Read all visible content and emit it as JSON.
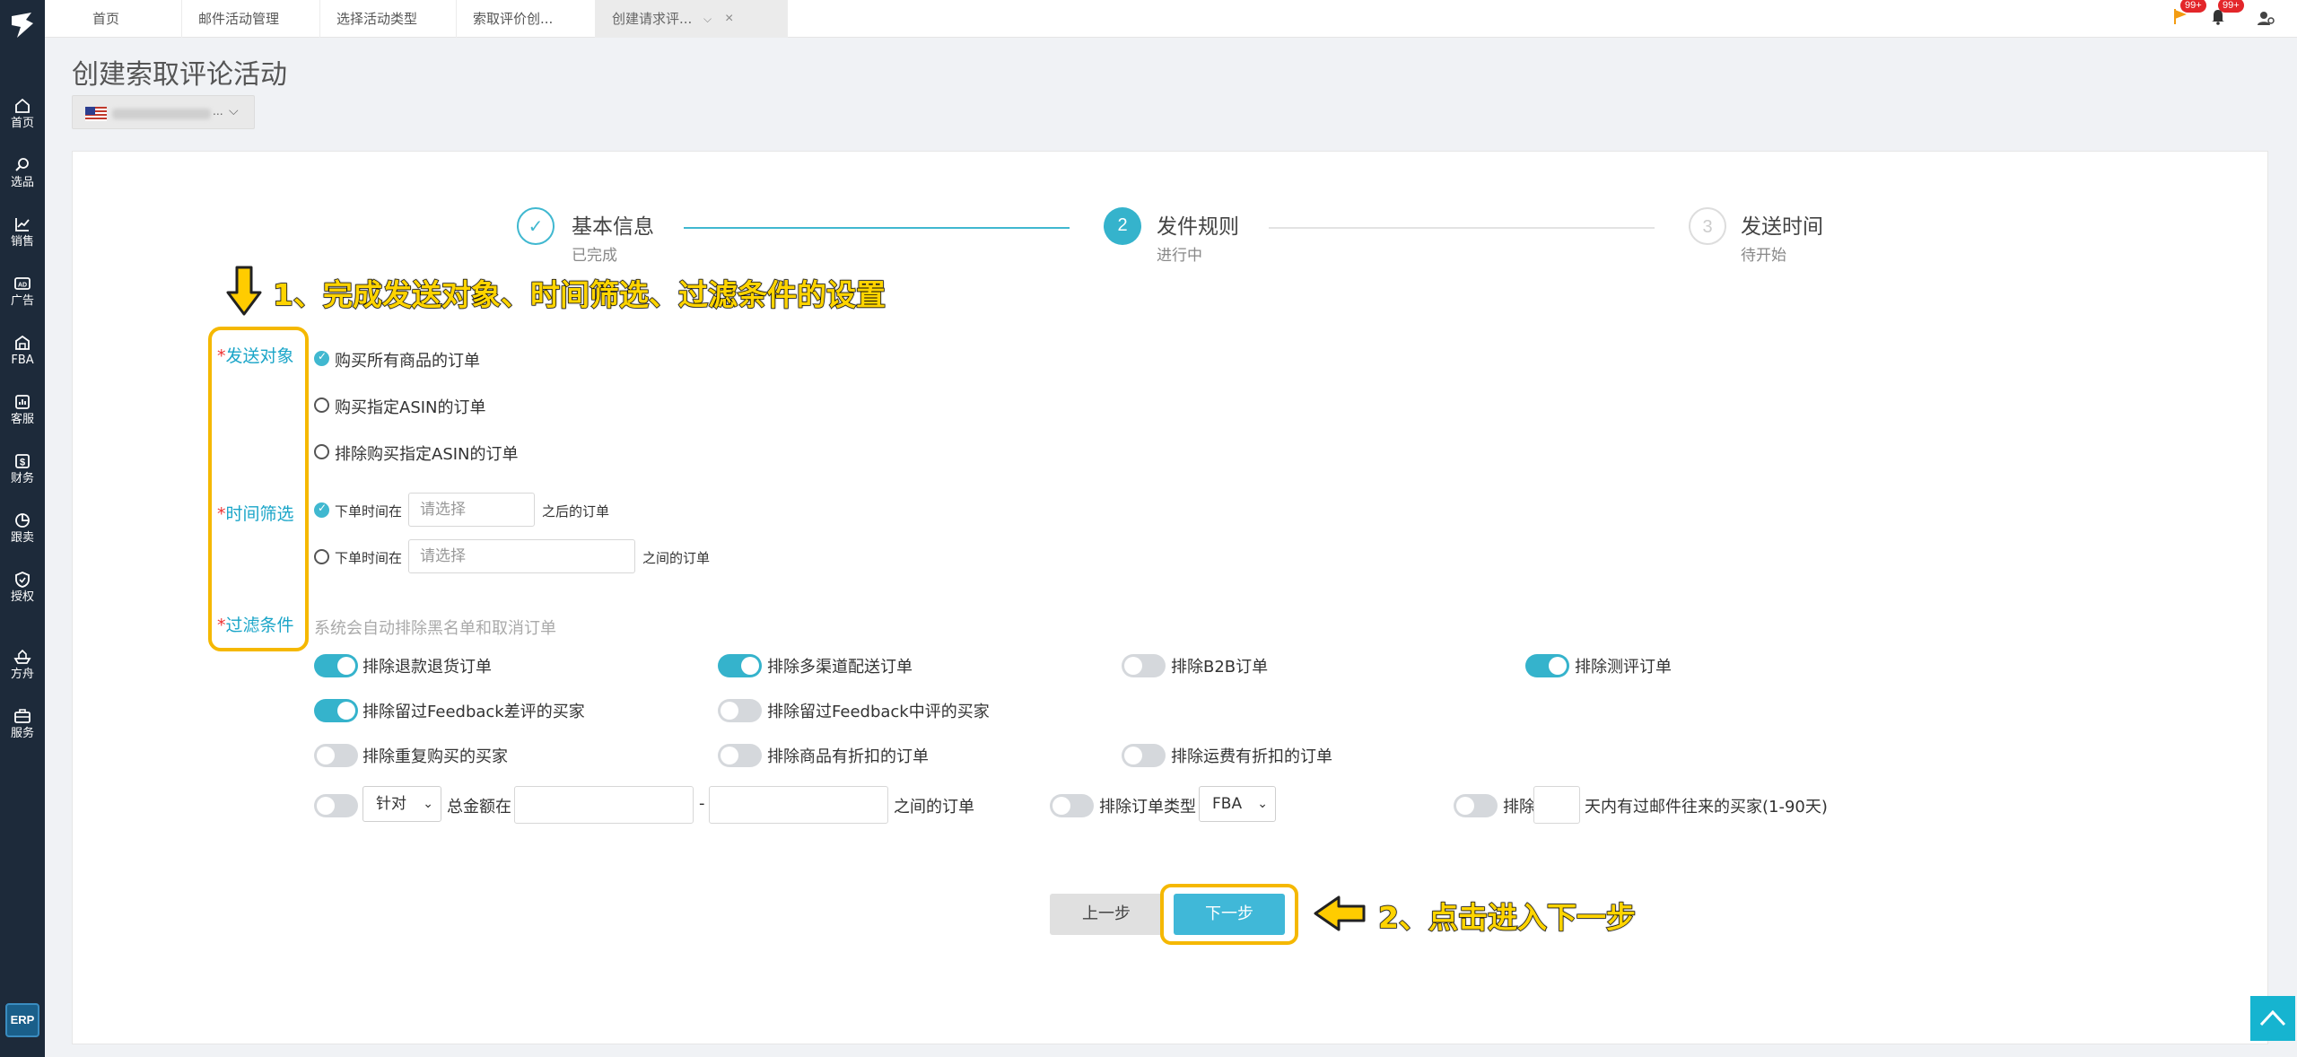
{
  "sidebar": {
    "items": [
      {
        "label": "首页",
        "icon": "home-icon"
      },
      {
        "label": "选品",
        "icon": "search-icon"
      },
      {
        "label": "销售",
        "icon": "chart-icon"
      },
      {
        "label": "广告",
        "icon": "ad-icon"
      },
      {
        "label": "FBA",
        "icon": "warehouse-icon"
      },
      {
        "label": "客服",
        "icon": "service-icon"
      },
      {
        "label": "财务",
        "icon": "finance-icon"
      },
      {
        "label": "跟卖",
        "icon": "pie-icon"
      },
      {
        "label": "授权",
        "icon": "shield-icon"
      },
      {
        "label": "方舟",
        "icon": "ark-icon"
      },
      {
        "label": "服务",
        "icon": "briefcase-icon"
      }
    ],
    "erp_label": "ERP"
  },
  "tabs": [
    {
      "label": "首页"
    },
    {
      "label": "邮件活动管理"
    },
    {
      "label": "选择活动类型"
    },
    {
      "label": "索取评价创..."
    },
    {
      "label": "创建请求评..."
    }
  ],
  "topbar": {
    "flag_badge": "99+",
    "bell_badge": "99+"
  },
  "page": {
    "title": "创建索取评论活动",
    "store_ellipsis": "..."
  },
  "steps": [
    {
      "number": "✓",
      "title": "基本信息",
      "status": "已完成"
    },
    {
      "number": "2",
      "title": "发件规则",
      "status": "进行中"
    },
    {
      "number": "3",
      "title": "发送时间",
      "status": "待开始"
    }
  ],
  "annotations": {
    "step1": "1、完成发送对象、时间筛选、过滤条件的设置",
    "step2": "2、点击进入下一步"
  },
  "form": {
    "recipient": {
      "label": "发送对象",
      "options": [
        "购买所有商品的订单",
        "购买指定ASIN的订单",
        "排除购买指定ASIN的订单"
      ],
      "selected": 0
    },
    "time": {
      "label": "时间筛选",
      "row1": {
        "prefix": "下单时间在",
        "placeholder": "请选择",
        "suffix": "之后的订单"
      },
      "row2": {
        "prefix": "下单时间在",
        "placeholder": "请选择",
        "suffix": "之间的订单"
      }
    },
    "filter": {
      "label": "过滤条件",
      "hint": "系统会自动排除黑名单和取消订单",
      "toggles": [
        {
          "label": "排除退款退货订单",
          "on": true
        },
        {
          "label": "排除多渠道配送订单",
          "on": true
        },
        {
          "label": "排除B2B订单",
          "on": false
        },
        {
          "label": "排除测评订单",
          "on": true
        },
        {
          "label": "排除留过Feedback差评的买家",
          "on": true
        },
        {
          "label": "排除留过Feedback中评的买家",
          "on": false
        },
        {
          "label": "排除重复购买的买家",
          "on": false
        },
        {
          "label": "排除商品有折扣的订单",
          "on": false
        },
        {
          "label": "排除运费有折扣的订单",
          "on": false
        }
      ],
      "amount": {
        "select": "针对",
        "label": "总金额在",
        "dash": "-",
        "suffix": "之间的订单"
      },
      "order_type": {
        "label": "排除订单类型",
        "select": "FBA"
      },
      "mail_days": {
        "prefix": "排除",
        "suffix": "天内有过邮件往来的买家(1-90天)"
      }
    }
  },
  "buttons": {
    "prev": "上一步",
    "next": "下一步"
  },
  "colors": {
    "accent": "#35b3cc",
    "highlight": "#f5b800",
    "sidebar": "#1d2a3a",
    "required": "#e33333"
  }
}
